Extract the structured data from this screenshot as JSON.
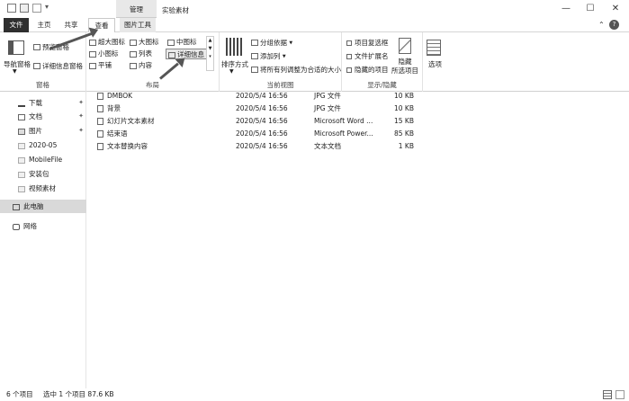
{
  "titlebar": {
    "context_group": "管理",
    "title": "实验素材",
    "quick_access_more": "▾",
    "minimize": "—",
    "maximize": "☐",
    "close": "✕"
  },
  "tabs": {
    "file": "文件",
    "home": "主页",
    "share": "共享",
    "view": "查看",
    "picture_tools": "图片工具",
    "help_collapse": "⌃"
  },
  "ribbon": {
    "panes": {
      "navigation_pane": "导航窗格",
      "preview_pane": "预览窗格",
      "details_pane": "详细信息窗格",
      "group_label": "窗格"
    },
    "layout": {
      "extra_large": "超大图标",
      "large": "大图标",
      "medium": "中图标",
      "small": "小图标",
      "list": "列表",
      "details": "详细信息",
      "tiles": "平铺",
      "content": "内容",
      "group_label": "布局"
    },
    "current_view": {
      "sort_by": "排序方式",
      "group_by": "分组依据",
      "add_columns": "添加列",
      "size_all_columns": "将所有列调整为合适的大小",
      "group_label": "当前视图"
    },
    "show_hide": {
      "item_checkboxes": "项目复选框",
      "file_extensions": "文件扩展名",
      "hidden_items": "隐藏的项目",
      "hide_selected_line1": "隐藏",
      "hide_selected_line2": "所选项目",
      "group_label": "显示/隐藏"
    },
    "options": "选项"
  },
  "navpane": {
    "items": [
      {
        "label": "下载",
        "pinned": true
      },
      {
        "label": "文档",
        "pinned": true
      },
      {
        "label": "图片",
        "pinned": true
      },
      {
        "label": "2020-05",
        "pinned": false
      },
      {
        "label": "MobileFile",
        "pinned": false
      },
      {
        "label": "安装包",
        "pinned": false
      },
      {
        "label": "视频素材",
        "pinned": false
      },
      {
        "label": "此电脑",
        "pinned": false
      },
      {
        "label": "网络",
        "pinned": false
      }
    ],
    "pin_glyph": "✦"
  },
  "files": [
    {
      "name": "DMBOK",
      "date": "2020/5/4 16:56",
      "type": "JPG 文件",
      "size": "10 KB"
    },
    {
      "name": "背景",
      "date": "2020/5/4 16:56",
      "type": "JPG 文件",
      "size": "10 KB"
    },
    {
      "name": "幻灯片文本素材",
      "date": "2020/5/4 16:56",
      "type": "Microsoft Word ...",
      "size": "15 KB"
    },
    {
      "name": "结束语",
      "date": "2020/5/4 16:56",
      "type": "Microsoft Power...",
      "size": "85 KB"
    },
    {
      "name": "文本替换内容",
      "date": "2020/5/4 16:56",
      "type": "文本文档",
      "size": "1 KB"
    }
  ],
  "status": {
    "count": "6 个项目",
    "selection": "选中 1 个项目  87.6 KB"
  }
}
